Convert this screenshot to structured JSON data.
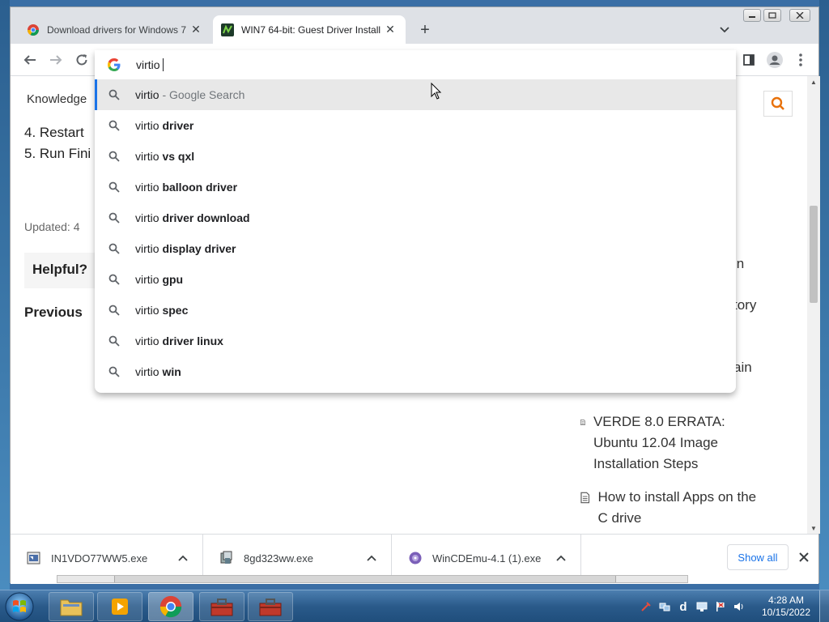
{
  "browser": {
    "tabs": [
      {
        "title": "Download drivers for Windows 7",
        "active": false
      },
      {
        "title": "WIN7 64-bit: Guest Driver Install",
        "active": true
      }
    ],
    "new_tab": "+",
    "tab_close": "✕"
  },
  "omnibox": {
    "typed": "virtio",
    "suggestions": [
      {
        "prefix": "virtio",
        "bold": "",
        "rest": " - Google Search",
        "selected": true
      },
      {
        "prefix": "virtio",
        "bold": " driver",
        "rest": ""
      },
      {
        "prefix": "virtio",
        "bold": " vs qxl",
        "rest": ""
      },
      {
        "prefix": "virtio",
        "bold": " balloon driver",
        "rest": ""
      },
      {
        "prefix": "virtio",
        "bold": " driver download",
        "rest": ""
      },
      {
        "prefix": "virtio",
        "bold": " display driver",
        "rest": ""
      },
      {
        "prefix": "virtio",
        "bold": " gpu",
        "rest": ""
      },
      {
        "prefix": "virtio",
        "bold": " spec",
        "rest": ""
      },
      {
        "prefix": "virtio",
        "bold": " driver linux",
        "rest": ""
      },
      {
        "prefix": "virtio",
        "bold": " win",
        "rest": ""
      }
    ]
  },
  "page": {
    "knowledge_label": "Knowledge",
    "steps": [
      "4. Restart",
      "5. Run Fini"
    ],
    "updated": "Updated: 4",
    "helpful": "Helpful?",
    "previous": "Previous",
    "side_fragments": [
      "in",
      "tory",
      "ain"
    ],
    "related": [
      {
        "title": "VERDE 8.0 ERRATA: Ubuntu 12.04 Image Installation Steps"
      },
      {
        "title": "How to install Apps on the C drive"
      }
    ]
  },
  "downloads": {
    "items": [
      {
        "name": "IN1VDO77WW5.exe"
      },
      {
        "name": "8gd323ww.exe"
      },
      {
        "name": "WinCDEmu-4.1 (1).exe"
      }
    ],
    "show_all": "Show all"
  },
  "taskbar": {
    "time": "4:28 AM",
    "date": "10/15/2022"
  },
  "colors": {
    "accent": "#1a73e8",
    "search_orange": "#e8710a",
    "taskbar": "#2a5a8a"
  }
}
